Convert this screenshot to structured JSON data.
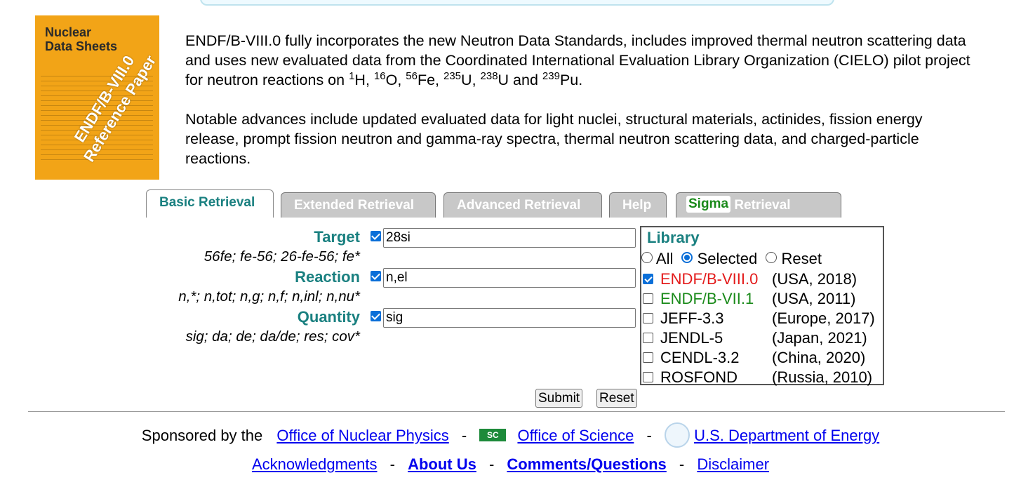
{
  "cover": {
    "title_line1": "Nuclear",
    "title_line2": "Data Sheets",
    "band_line1": "ENDF/B-VIII.0",
    "band_line2": "Reference Paper"
  },
  "intro": {
    "p1_a": "ENDF/B-VIII.0 fully incorporates the new Neutron Data Standards, includes improved thermal neutron scattering data and uses new evaluated data from the Coordinated International Evaluation Library Organization (CIELO) pilot project for neutron reactions on ",
    "nuclides": [
      {
        "mass": "1",
        "sym": "H",
        "after": ", "
      },
      {
        "mass": "16",
        "sym": "O",
        "after": ", "
      },
      {
        "mass": "56",
        "sym": "Fe",
        "after": ", "
      },
      {
        "mass": "235",
        "sym": "U",
        "after": ", "
      },
      {
        "mass": "238",
        "sym": "U",
        "after": " and "
      },
      {
        "mass": "239",
        "sym": "Pu",
        "after": "."
      }
    ],
    "p2": "Notable advances include updated evaluated data for light nuclei, structural materials, actinides, fission energy release, prompt fission neutron and gamma-ray spectra, thermal neutron scattering data, and charged-particle reactions."
  },
  "tabs": [
    {
      "label": "Basic Retrieval",
      "active": true
    },
    {
      "label": "Extended Retrieval",
      "active": false
    },
    {
      "label": "Advanced Retrieval",
      "active": false
    },
    {
      "label": "Help",
      "active": false
    },
    {
      "label": "Retrieval",
      "logo": "Sigma",
      "active": false
    }
  ],
  "form": {
    "target": {
      "label": "Target",
      "hint": "56fe; fe-56; 26-fe-56; fe*",
      "value": "28si",
      "checked": true
    },
    "reaction": {
      "label": "Reaction",
      "hint": "n,*; n,tot; n,g; n,f; n,inl; n,nu*",
      "value": "n,el",
      "checked": true
    },
    "quantity": {
      "label": "Quantity",
      "hint": "sig; da; de; da/de; res; cov*",
      "value": "sig",
      "checked": true
    }
  },
  "library": {
    "title": "Library",
    "radio": {
      "all": "All",
      "selected": "Selected",
      "reset": "Reset",
      "current": "selected"
    },
    "items": [
      {
        "name": "ENDF/B-VIII.0",
        "meta": "(USA, 2018)",
        "checked": true,
        "color": "#e31b1b"
      },
      {
        "name": "ENDF/B-VII.1",
        "meta": "(USA, 2011)",
        "checked": false,
        "color": "#1a8a1a"
      },
      {
        "name": "JEFF-3.3",
        "meta": "(Europe, 2017)",
        "checked": false,
        "color": "#000000"
      },
      {
        "name": "JENDL-5",
        "meta": "(Japan, 2021)",
        "checked": false,
        "color": "#000000"
      },
      {
        "name": "CENDL-3.2",
        "meta": "(China, 2020)",
        "checked": false,
        "color": "#000000"
      },
      {
        "name": "ROSFOND",
        "meta": "(Russia, 2010)",
        "checked": false,
        "color": "#000000"
      }
    ]
  },
  "buttons": {
    "submit": "Submit",
    "reset": "Reset"
  },
  "footer": {
    "sponsored": "Sponsored by the",
    "onp": "Office of Nuclear Physics",
    "sc_logo": "SC",
    "os": "Office of Science",
    "doe": "U.S. Department of Energy",
    "dash": "-",
    "ack": "Acknowledgments",
    "about": "About Us",
    "comments": "Comments/Questions",
    "disclaimer": "Disclaimer"
  }
}
